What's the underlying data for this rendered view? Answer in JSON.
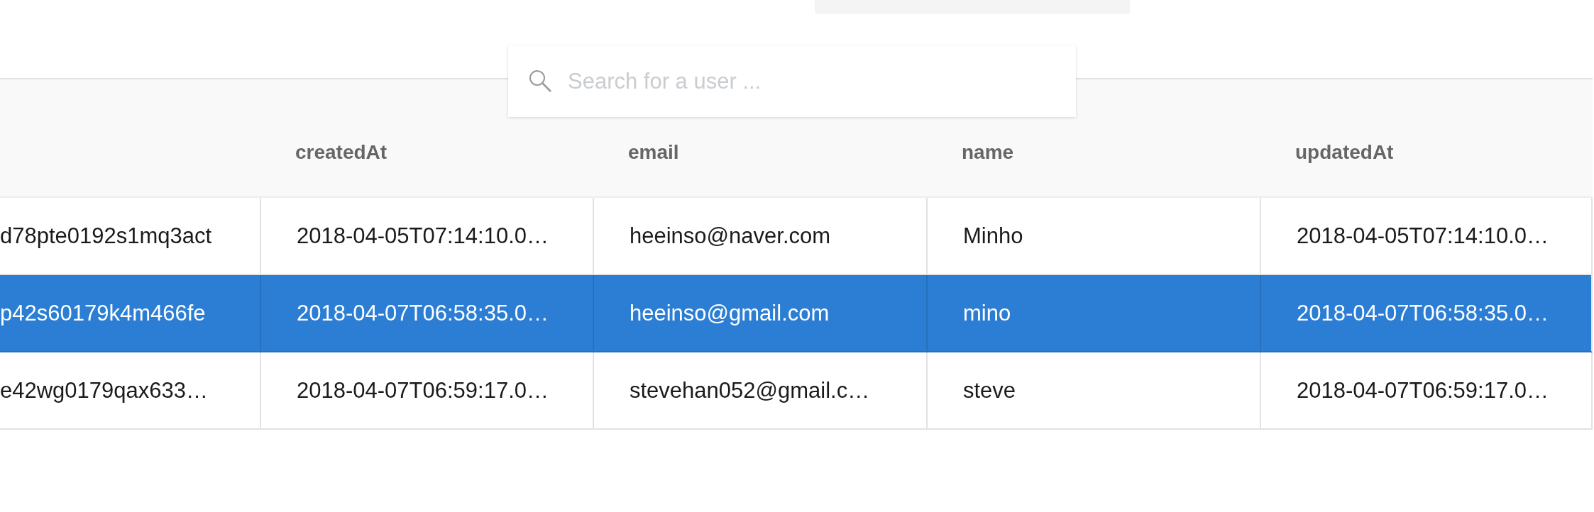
{
  "search": {
    "placeholder": "Search for a user ..."
  },
  "table": {
    "columns": [
      "",
      "createdAt",
      "email",
      "name",
      "updatedAt"
    ],
    "rows": [
      {
        "selected": false,
        "cells": [
          "d78pte0192s1mq3act",
          "2018-04-05T07:14:10.0…",
          "heeinso@naver.com",
          "Minho",
          "2018-04-05T07:14:10.0…"
        ]
      },
      {
        "selected": true,
        "cells": [
          "p42s60179k4m466fe",
          "2018-04-07T06:58:35.0…",
          "heeinso@gmail.com",
          "mino",
          "2018-04-07T06:58:35.0…"
        ]
      },
      {
        "selected": false,
        "cells": [
          "e42wg0179qax633…",
          "2018-04-07T06:59:17.0…",
          "stevehan052@gmail.c…",
          "steve",
          "2018-04-07T06:59:17.0…"
        ]
      }
    ]
  }
}
